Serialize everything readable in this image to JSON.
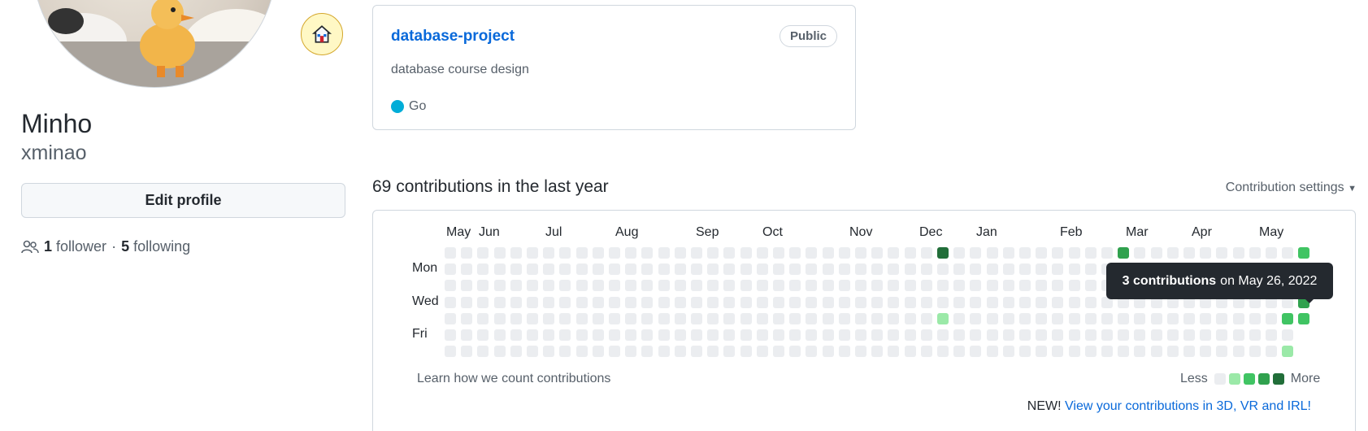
{
  "profile": {
    "name": "Minho",
    "username": "xminao",
    "edit_label": "Edit profile",
    "followers_count": "1",
    "followers_label": "follower",
    "separator": "·",
    "following_count": "5",
    "following_label": "following",
    "status_icon": "house-icon"
  },
  "repo": {
    "name": "database-project",
    "visibility": "Public",
    "description": "database course design",
    "language": "Go",
    "language_color": "#00ADD8"
  },
  "contributions": {
    "title": "69 contributions in the last year",
    "settings_label": "Contribution settings",
    "months": [
      "May",
      "Jun",
      "Jul",
      "Aug",
      "Sep",
      "Oct",
      "Nov",
      "Dec",
      "Jan",
      "Feb",
      "Mar",
      "Apr",
      "May"
    ],
    "days": [
      "Mon",
      "Wed",
      "Fri"
    ],
    "learn_label": "Learn how we count contributions",
    "legend_less": "Less",
    "legend_more": "More",
    "level_colors": [
      "#ebedf0",
      "#9be9a8",
      "#40c463",
      "#30a14e",
      "#216e39"
    ],
    "new_prefix": "NEW!",
    "new_link": "View your contributions in 3D, VR and IRL!",
    "tooltip_count": "3 contributions",
    "tooltip_date": "on May 26, 2022",
    "active_cells": [
      {
        "week": 30,
        "day": 0,
        "level": 4
      },
      {
        "week": 41,
        "day": 0,
        "level": 3
      },
      {
        "week": 30,
        "day": 4,
        "level": 1
      },
      {
        "week": 51,
        "day": 4,
        "level": 2
      },
      {
        "week": 52,
        "day": 4,
        "level": 2
      },
      {
        "week": 52,
        "day": 3,
        "level": 3
      },
      {
        "week": 51,
        "day": 6,
        "level": 1
      },
      {
        "week": 52,
        "day": 0,
        "level": 2
      }
    ]
  }
}
